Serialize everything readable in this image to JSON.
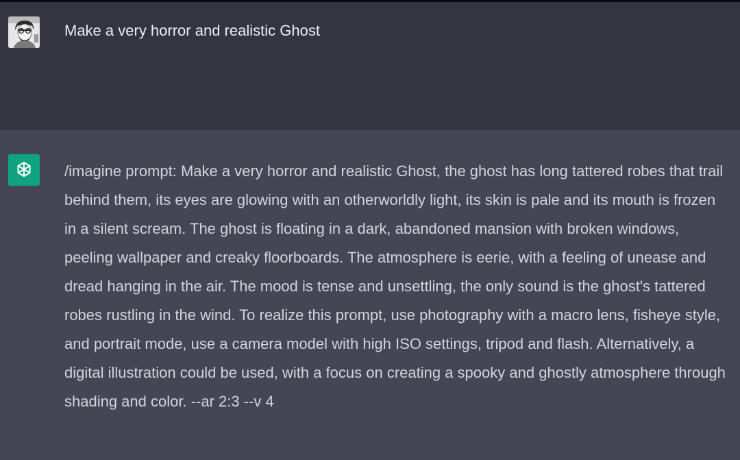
{
  "user_message": {
    "text": "Make a very horror and realistic Ghost",
    "avatar_icon": "user-avatar"
  },
  "assistant_message": {
    "text": "/imagine prompt: Make a very horror and realistic Ghost, the ghost has long tattered robes that trail behind them, its eyes are glowing with an otherworldly light, its skin is pale and its mouth is frozen in a silent scream. The ghost is floating in a dark, abandoned mansion with broken windows, peeling wallpaper and creaky floorboards. The atmosphere is eerie, with a feeling of unease and dread hanging in the air. The mood is tense and unsettling, the only sound is the ghost's tattered robes rustling in the wind. To realize this prompt, use photography with a macro lens, fisheye style, and portrait mode, use a camera model with high ISO settings, tripod and flash. Alternatively, a digital illustration could be used, with a focus on creating a spooky and ghostly atmosphere through shading and color. --ar 2:3 --v 4",
    "avatar_icon": "chatgpt-logo-icon",
    "avatar_color": "#10a37f"
  },
  "colors": {
    "user_bg": "#343541",
    "assistant_bg": "#444654",
    "user_text": "#ececf1",
    "assistant_text": "#d1d5db"
  }
}
